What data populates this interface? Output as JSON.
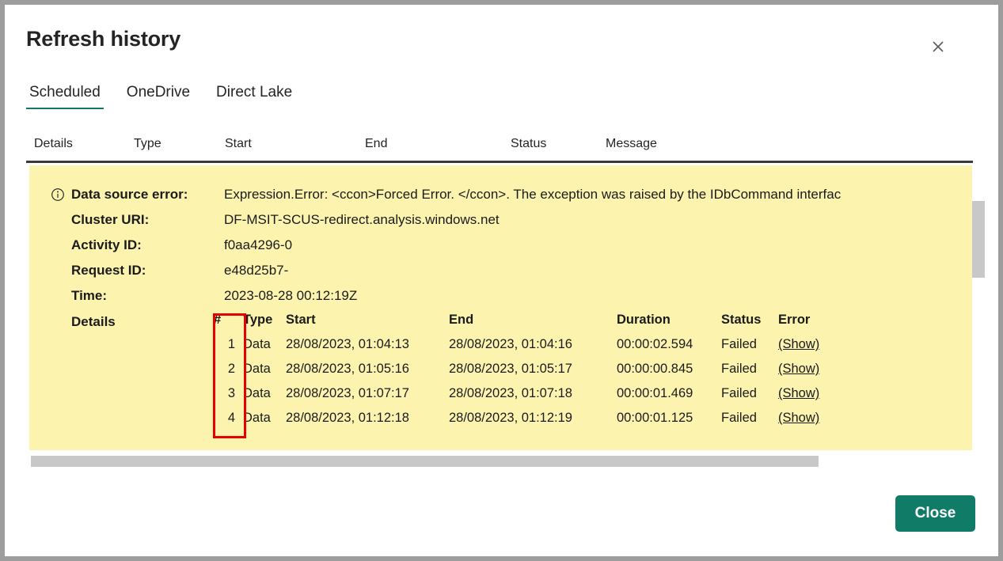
{
  "dialog": {
    "title": "Refresh history",
    "close_icon": "close-icon",
    "close_button_label": "Close"
  },
  "tabs": [
    {
      "label": "Scheduled",
      "active": true
    },
    {
      "label": "OneDrive",
      "active": false
    },
    {
      "label": "Direct Lake",
      "active": false
    }
  ],
  "columns": {
    "details": "Details",
    "type": "Type",
    "start": "Start",
    "end": "End",
    "status": "Status",
    "message": "Message"
  },
  "error_panel": {
    "icon": "info-icon",
    "fields": [
      {
        "key": "Data source error:",
        "value": "Expression.Error: <ccon>Forced Error. </ccon>. The exception was raised by the IDbCommand interfac"
      },
      {
        "key": "Cluster URI:",
        "value": "DF-MSIT-SCUS-redirect.analysis.windows.net"
      },
      {
        "key": "Activity ID:",
        "value": "f0aa4296-0"
      },
      {
        "key": "Request ID:",
        "value": "e48d25b7-"
      },
      {
        "key": "Time:",
        "value": "2023-08-28 00:12:19Z"
      }
    ],
    "details_label": "Details",
    "details_table": {
      "headers": [
        "#",
        "Type",
        "Start",
        "End",
        "Duration",
        "Status",
        "Error"
      ],
      "rows": [
        {
          "num": "1",
          "type": "Data",
          "start": "28/08/2023, 01:04:13",
          "end": "28/08/2023, 01:04:16",
          "duration": "00:00:02.594",
          "status": "Failed",
          "error": "(Show)"
        },
        {
          "num": "2",
          "type": "Data",
          "start": "28/08/2023, 01:05:16",
          "end": "28/08/2023, 01:05:17",
          "duration": "00:00:00.845",
          "status": "Failed",
          "error": "(Show)"
        },
        {
          "num": "3",
          "type": "Data",
          "start": "28/08/2023, 01:07:17",
          "end": "28/08/2023, 01:07:18",
          "duration": "00:00:01.469",
          "status": "Failed",
          "error": "(Show)"
        },
        {
          "num": "4",
          "type": "Data",
          "start": "28/08/2023, 01:12:18",
          "end": "28/08/2023, 01:12:19",
          "duration": "00:00:01.125",
          "status": "Failed",
          "error": "(Show)"
        }
      ]
    }
  },
  "colors": {
    "accent": "#107c68",
    "panel_background": "#fbf3ae",
    "annotation": "#e60000",
    "scrollbar": "#c8c8c8",
    "window_border": "#9d9d9d"
  }
}
